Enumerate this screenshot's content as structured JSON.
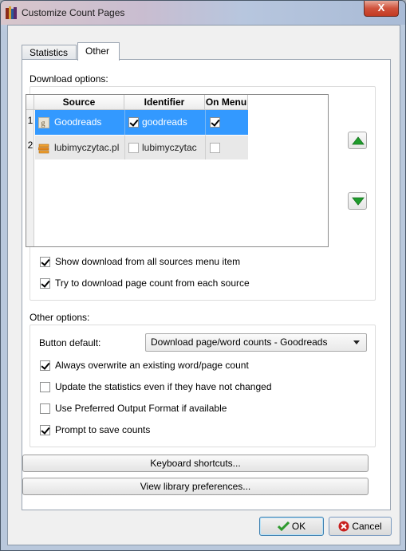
{
  "window": {
    "title": "Customize Count Pages",
    "close_label": "X"
  },
  "tabs": [
    {
      "label": "Statistics",
      "active": false
    },
    {
      "label": "Other",
      "active": true
    }
  ],
  "download": {
    "section_label": "Download options:",
    "columns": [
      "Source",
      "Identifier",
      "On Menu"
    ],
    "rows": [
      {
        "num": "1",
        "icon": "goodreads-icon",
        "source": "Goodreads",
        "identifier_checked": true,
        "identifier": "goodreads",
        "on_menu": true,
        "selected": true
      },
      {
        "num": "2",
        "icon": "book-stack-icon",
        "source": "lubimyczytac.pl",
        "identifier_checked": false,
        "identifier": "lubimyczytac",
        "on_menu": false,
        "selected": false
      }
    ],
    "move_up_icon": "up-arrow-icon",
    "move_down_icon": "down-arrow-icon",
    "options": [
      {
        "label": "Show download from all sources menu item",
        "checked": true
      },
      {
        "label": "Try to download page count from each source",
        "checked": true
      }
    ]
  },
  "other": {
    "section_label": "Other options:",
    "button_default_label": "Button default:",
    "button_default_value": "Download page/word counts - Goodreads",
    "options": [
      {
        "label": "Always overwrite an existing word/page count",
        "checked": true
      },
      {
        "label": "Update the statistics even if they have not changed",
        "checked": false
      },
      {
        "label": "Use Preferred Output Format if available",
        "checked": false
      },
      {
        "label": "Prompt to save counts",
        "checked": true
      }
    ]
  },
  "buttons": {
    "keyboard_shortcuts": "Keyboard shortcuts...",
    "view_library_prefs": "View library preferences...",
    "ok": "OK",
    "cancel": "Cancel"
  },
  "colors": {
    "selection": "#3399ff",
    "ok_green": "#2e9a2e",
    "cancel_red": "#c8201e",
    "arrow_green": "#1f9c2c"
  }
}
